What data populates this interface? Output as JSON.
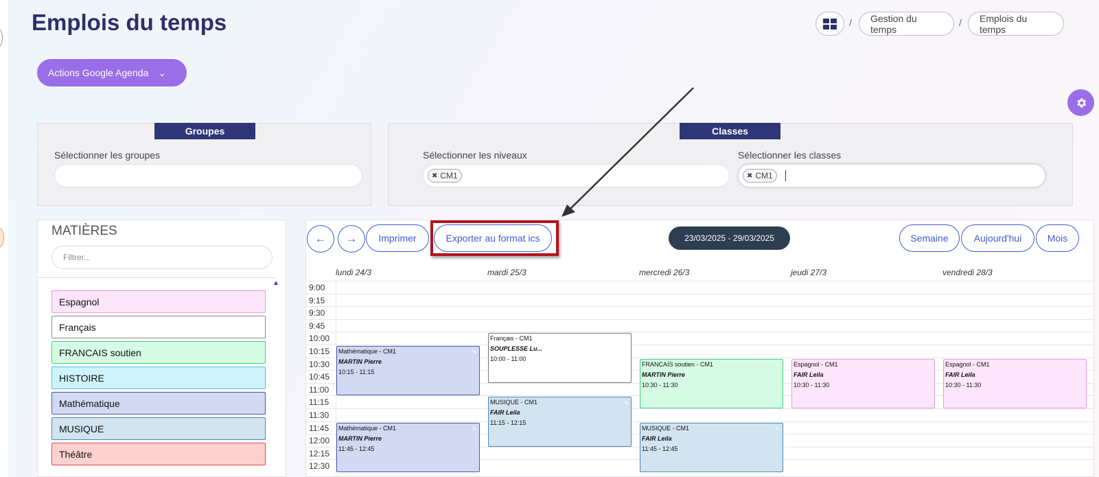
{
  "page": {
    "title": "Emplois du temps"
  },
  "breadcrumb": {
    "items": [
      "Gestion du temps",
      "Emplois du temps"
    ]
  },
  "google_button": {
    "label": "Actions Google Agenda"
  },
  "groupes": {
    "title": "Groupes",
    "label": "Sélectionner les groupes"
  },
  "classes": {
    "title": "Classes",
    "niveaux_label": "Sélectionner les niveaux",
    "niveaux_tag": "CM1",
    "classes_label": "Sélectionner les classes",
    "classes_tag": "CM1"
  },
  "matieres": {
    "title": "MATIÈRES",
    "filter_placeholder": "Filtrer...",
    "items": [
      {
        "label": "Espagnol",
        "bg": "#fde6fb",
        "border": "#e69be0"
      },
      {
        "label": "Français",
        "bg": "#ffffff",
        "border": "#8a8a8a"
      },
      {
        "label": "FRANCAIS soutien",
        "bg": "#d6fbe4",
        "border": "#4fcf7c"
      },
      {
        "label": "HISTOIRE",
        "bg": "#cef3fb",
        "border": "#4ec4de"
      },
      {
        "label": "Mathématique",
        "bg": "#d2d9f2",
        "border": "#4a5aa8"
      },
      {
        "label": "MUSIQUE",
        "bg": "#d2e4f0",
        "border": "#4a88b8"
      },
      {
        "label": "Théâtre",
        "bg": "#ffd0d0",
        "border": "#e04848"
      }
    ]
  },
  "calendar": {
    "print_label": "Imprimer",
    "export_label": "Exporter au format ics",
    "date_range": "23/03/2025 - 29/03/2025",
    "view_buttons": [
      "Semaine",
      "Aujourd'hui",
      "Mois"
    ],
    "days": [
      "lundi 24/3",
      "mardi 25/3",
      "mercredi 26/3",
      "jeudi 27/3",
      "vendredi 28/3"
    ],
    "times": [
      "9:00",
      "9:15",
      "9:30",
      "9:45",
      "10:00",
      "10:15",
      "10:30",
      "10:45",
      "11:00",
      "11:15",
      "11:30",
      "11:45",
      "12:00",
      "12:15",
      "12:30"
    ],
    "events": [
      {
        "title": "Mathématique - CM1",
        "teacher": "MARTIN Pierre",
        "time": "10:15 - 11:15"
      },
      {
        "title": "Mathématique - CM1",
        "teacher": "MARTIN Pierre",
        "time": "11:45 - 12:45"
      },
      {
        "title": "Français - CM1",
        "teacher": "SOUPLESSE Lu...",
        "time": "10:00 - 11:00"
      },
      {
        "title": "MUSIQUE - CM1",
        "teacher": "FAIR Leila",
        "time": "11:15 - 12:15"
      },
      {
        "title": "FRANCAIS soutien - CM1",
        "teacher": "MARTIN Pierre",
        "time": "10:30 - 11:30"
      },
      {
        "title": "MUSIQUE - CM1",
        "teacher": "FAIR Leila",
        "time": "11:45 - 12:45"
      },
      {
        "title": "Espagnol - CM1",
        "teacher": "FAIR Leila",
        "time": "10:30 - 11:30"
      },
      {
        "title": "Espagnol - CM1",
        "teacher": "FAIR Leila",
        "time": "10:30 - 11:30"
      }
    ]
  },
  "icons": {
    "apps": "grid-icon",
    "settings": "gear-icon",
    "prev": "arrow-left-icon",
    "next": "arrow-right-icon",
    "edit": "pencil-icon"
  }
}
